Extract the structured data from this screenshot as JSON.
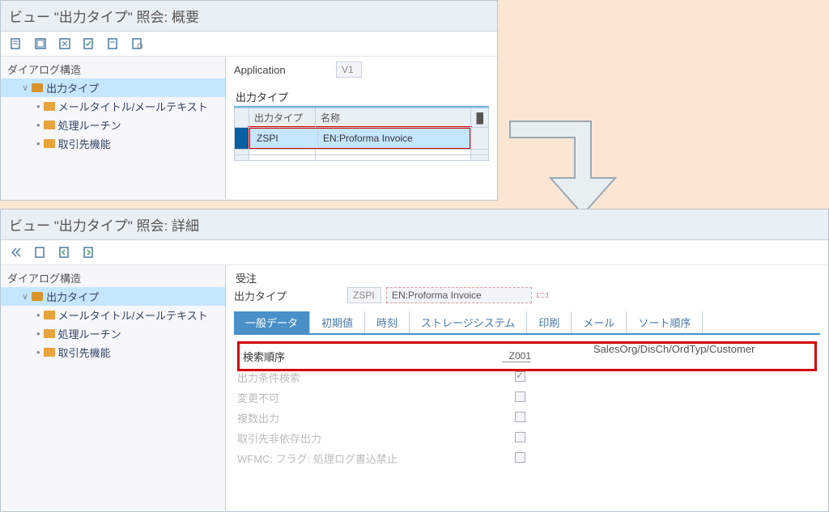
{
  "window1": {
    "title": "ビュー \"出力タイプ\" 照会: 概要",
    "sidebar_header": "ダイアログ構造",
    "tree": {
      "root": "出力タイプ",
      "children": [
        "メールタイトル/メールテキスト",
        "処理ルーチン",
        "取引先機能"
      ]
    },
    "application_label": "Application",
    "application_value": "V1",
    "section_header": "出力タイプ",
    "columns": {
      "col1": "出力タイプ",
      "col2": "名称"
    },
    "row": {
      "code": "ZSPI",
      "name": "EN:Proforma Invoice"
    }
  },
  "window2": {
    "title": "ビュー \"出力タイプ\" 照会: 詳細",
    "sidebar_header": "ダイアログ構造",
    "tree": {
      "root": "出力タイプ",
      "children": [
        "メールタイトル/メールテキスト",
        "処理ルーチン",
        "取引先機能"
      ]
    },
    "section_header": "受注",
    "output_type_label": "出力タイプ",
    "output_type_code": "ZSPI",
    "output_type_name": "EN:Proforma Invoice",
    "tabs": [
      "一般データ",
      "初期値",
      "時刻",
      "ストレージシステム",
      "印刷",
      "メール",
      "ソート順序"
    ],
    "fields": {
      "search_seq_label": "検索順序",
      "search_seq_value": "Z001",
      "search_seq_desc": "SalesOrg/DisCh/OrdTyp/Customer",
      "cond_search_label": "出力条件検索",
      "cond_search_checked": true,
      "no_change_label": "変更不可",
      "multi_output_label": "複数出力",
      "partner_indep_label": "取引先非依存出力",
      "wfmc_label": "WFMC: フラグ: 処理ログ書込禁止"
    }
  }
}
